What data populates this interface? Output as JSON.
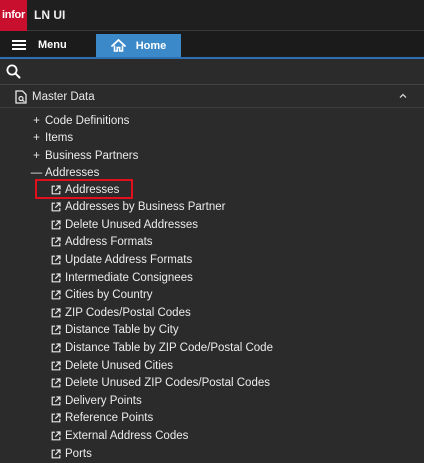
{
  "app": {
    "logo_text": "infor",
    "title": "LN UI"
  },
  "nav": {
    "menu_label": "Menu",
    "home_label": "Home",
    "accent": "#3b89c9"
  },
  "section": {
    "title": "Master Data"
  },
  "tree": {
    "folders": [
      {
        "toggle": "+",
        "label": "Code Definitions"
      },
      {
        "toggle": "+",
        "label": "Items"
      },
      {
        "toggle": "+",
        "label": "Business Partners"
      },
      {
        "toggle": "—",
        "label": "Addresses"
      }
    ],
    "items": [
      "Addresses",
      "Addresses by Business Partner",
      "Delete Unused Addresses",
      "Address Formats",
      "Update Address Formats",
      "Intermediate Consignees",
      "Cities by Country",
      "ZIP Codes/Postal Codes",
      "Distance Table by City",
      "Distance Table by ZIP Code/Postal Code",
      "Delete Unused Cities",
      "Delete Unused ZIP Codes/Postal Codes",
      "Delivery Points",
      "Reference Points",
      "External Address Codes",
      "Ports"
    ],
    "selected_item": "Addresses",
    "highlight_color": "#e2101c"
  }
}
